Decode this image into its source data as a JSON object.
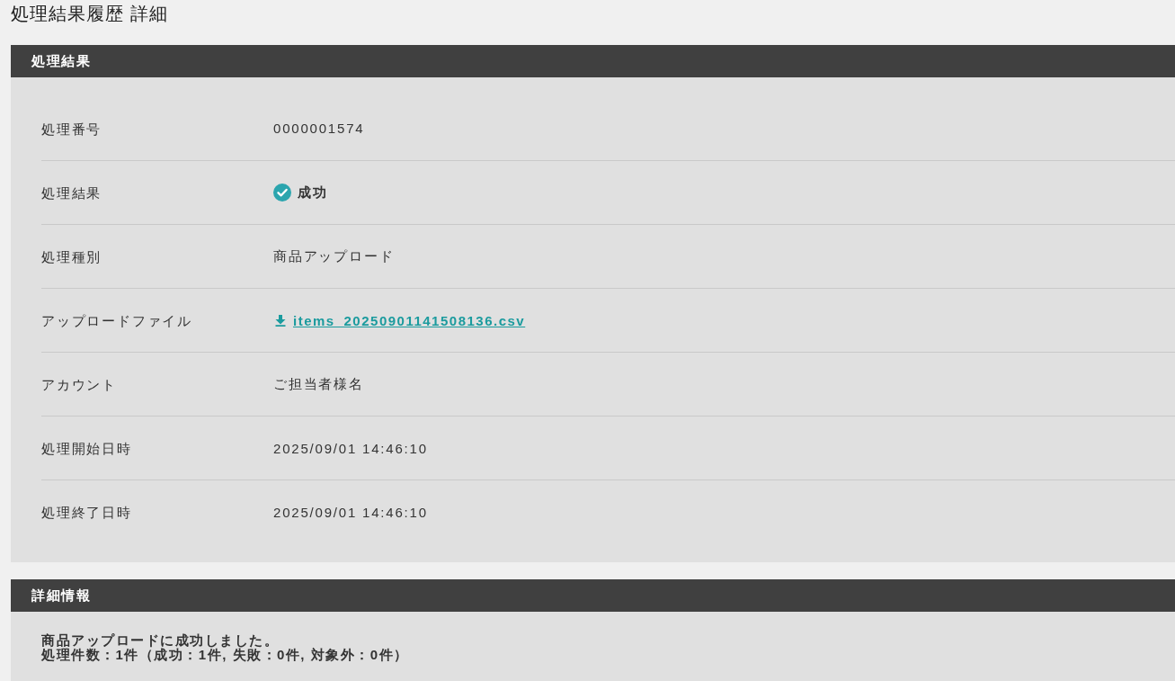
{
  "page_title": "処理結果履歴 詳細",
  "sections": [
    {
      "kind": "fields",
      "title": "処理結果",
      "fields": [
        {
          "kind": "text",
          "label": "処理番号",
          "value": "0000001574"
        },
        {
          "kind": "status",
          "label": "処理結果",
          "value": "成功",
          "succeeded": true
        },
        {
          "kind": "text",
          "label": "処理種別",
          "value": "商品アップロード"
        },
        {
          "kind": "download",
          "label": "アップロードファイル",
          "value": "items_20250901141508136.csv"
        },
        {
          "kind": "text",
          "label": "アカウント",
          "value": "ご担当者様名"
        },
        {
          "kind": "text",
          "label": "処理開始日時",
          "value": "2025/09/01 14:46:10"
        },
        {
          "kind": "text",
          "label": "処理終了日時",
          "value": "2025/09/01 14:46:10"
        }
      ]
    },
    {
      "kind": "message",
      "title": "詳細情報",
      "lines": [
        "商品アップロードに成功しました。",
        "処理件数：1件（成功：1件, 失敗：0件, 対象外：0件）"
      ]
    }
  ]
}
